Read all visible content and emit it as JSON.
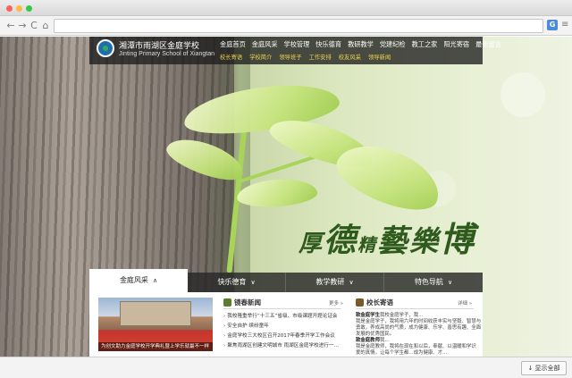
{
  "browser": {
    "colors": {
      "close": "#fc605c",
      "minimize": "#fdbc40",
      "maximize": "#34c84a"
    },
    "back_icon": "←",
    "forward_icon": "→",
    "reload_icon": "C",
    "home_icon": "⌂",
    "star_icon": "☆",
    "extension_label": "G",
    "menu_icon": "≡"
  },
  "site": {
    "school_name_cn": "湘潭市雨湖区金庭学校",
    "school_name_en": "Jinting Primary School of Xiangtan",
    "main_nav": [
      "金庭首页",
      "金庭风采",
      "学校管理",
      "快乐德育",
      "教研教学",
      "党建纪检",
      "教工之家",
      "阳光寄宿",
      "最新留言"
    ],
    "sub_nav": [
      "校长寄语",
      "学校简介",
      "领导班子",
      "工作安排",
      "校友风采",
      "领导新闻"
    ],
    "calligraphy": [
      "厚",
      "德",
      "精",
      "藝",
      "樂",
      "博"
    ]
  },
  "tabs": [
    {
      "label": "金庭风采",
      "icon": "∧"
    },
    {
      "label": "快乐德育",
      "icon": "∨"
    },
    {
      "label": "教学教研",
      "icon": "∨"
    },
    {
      "label": "特色导航",
      "icon": "∨"
    }
  ],
  "photo": {
    "caption": "为创文助力金庭学校开学典礼暨上学乐就最不一样"
  },
  "news": {
    "title": "镜春新闻",
    "more": "更多 »",
    "items": [
      "我校隆重举行“十三五”省级、市级课题开题论证会",
      "安全自护 缤纷童年",
      "金庭学校三大校区召开2017年春季开学工作会议",
      "聚焦雨湖区创建文明城市 雨湖区金庭学校进行一…"
    ]
  },
  "principal": {
    "title": "校长寄语",
    "more": "详细 »",
    "lines": [
      {
        "bold": "致金庭学生",
        "text": "我校金庭学子，我…"
      },
      {
        "bold": "",
        "text": "我是金庭学子，我将用六年的时间收获丰实与坚毅、智慧与"
      },
      {
        "bold": "",
        "text": "勇敢，养成高尚的气质，成为健康、乐学、善思有趣、全面"
      },
      {
        "bold": "",
        "text": "发展的优秀国民。"
      },
      {
        "bold": "致金庭教师",
        "text": "我…"
      },
      {
        "bold": "",
        "text": "我是金庭教师，我将在现在和以后，奉献、以温暖和学识"
      },
      {
        "bold": "",
        "text": "爱的真情，让每个学生都…成为健康、才…"
      }
    ]
  },
  "download": {
    "label": "显示全部",
    "icon": "↓"
  }
}
